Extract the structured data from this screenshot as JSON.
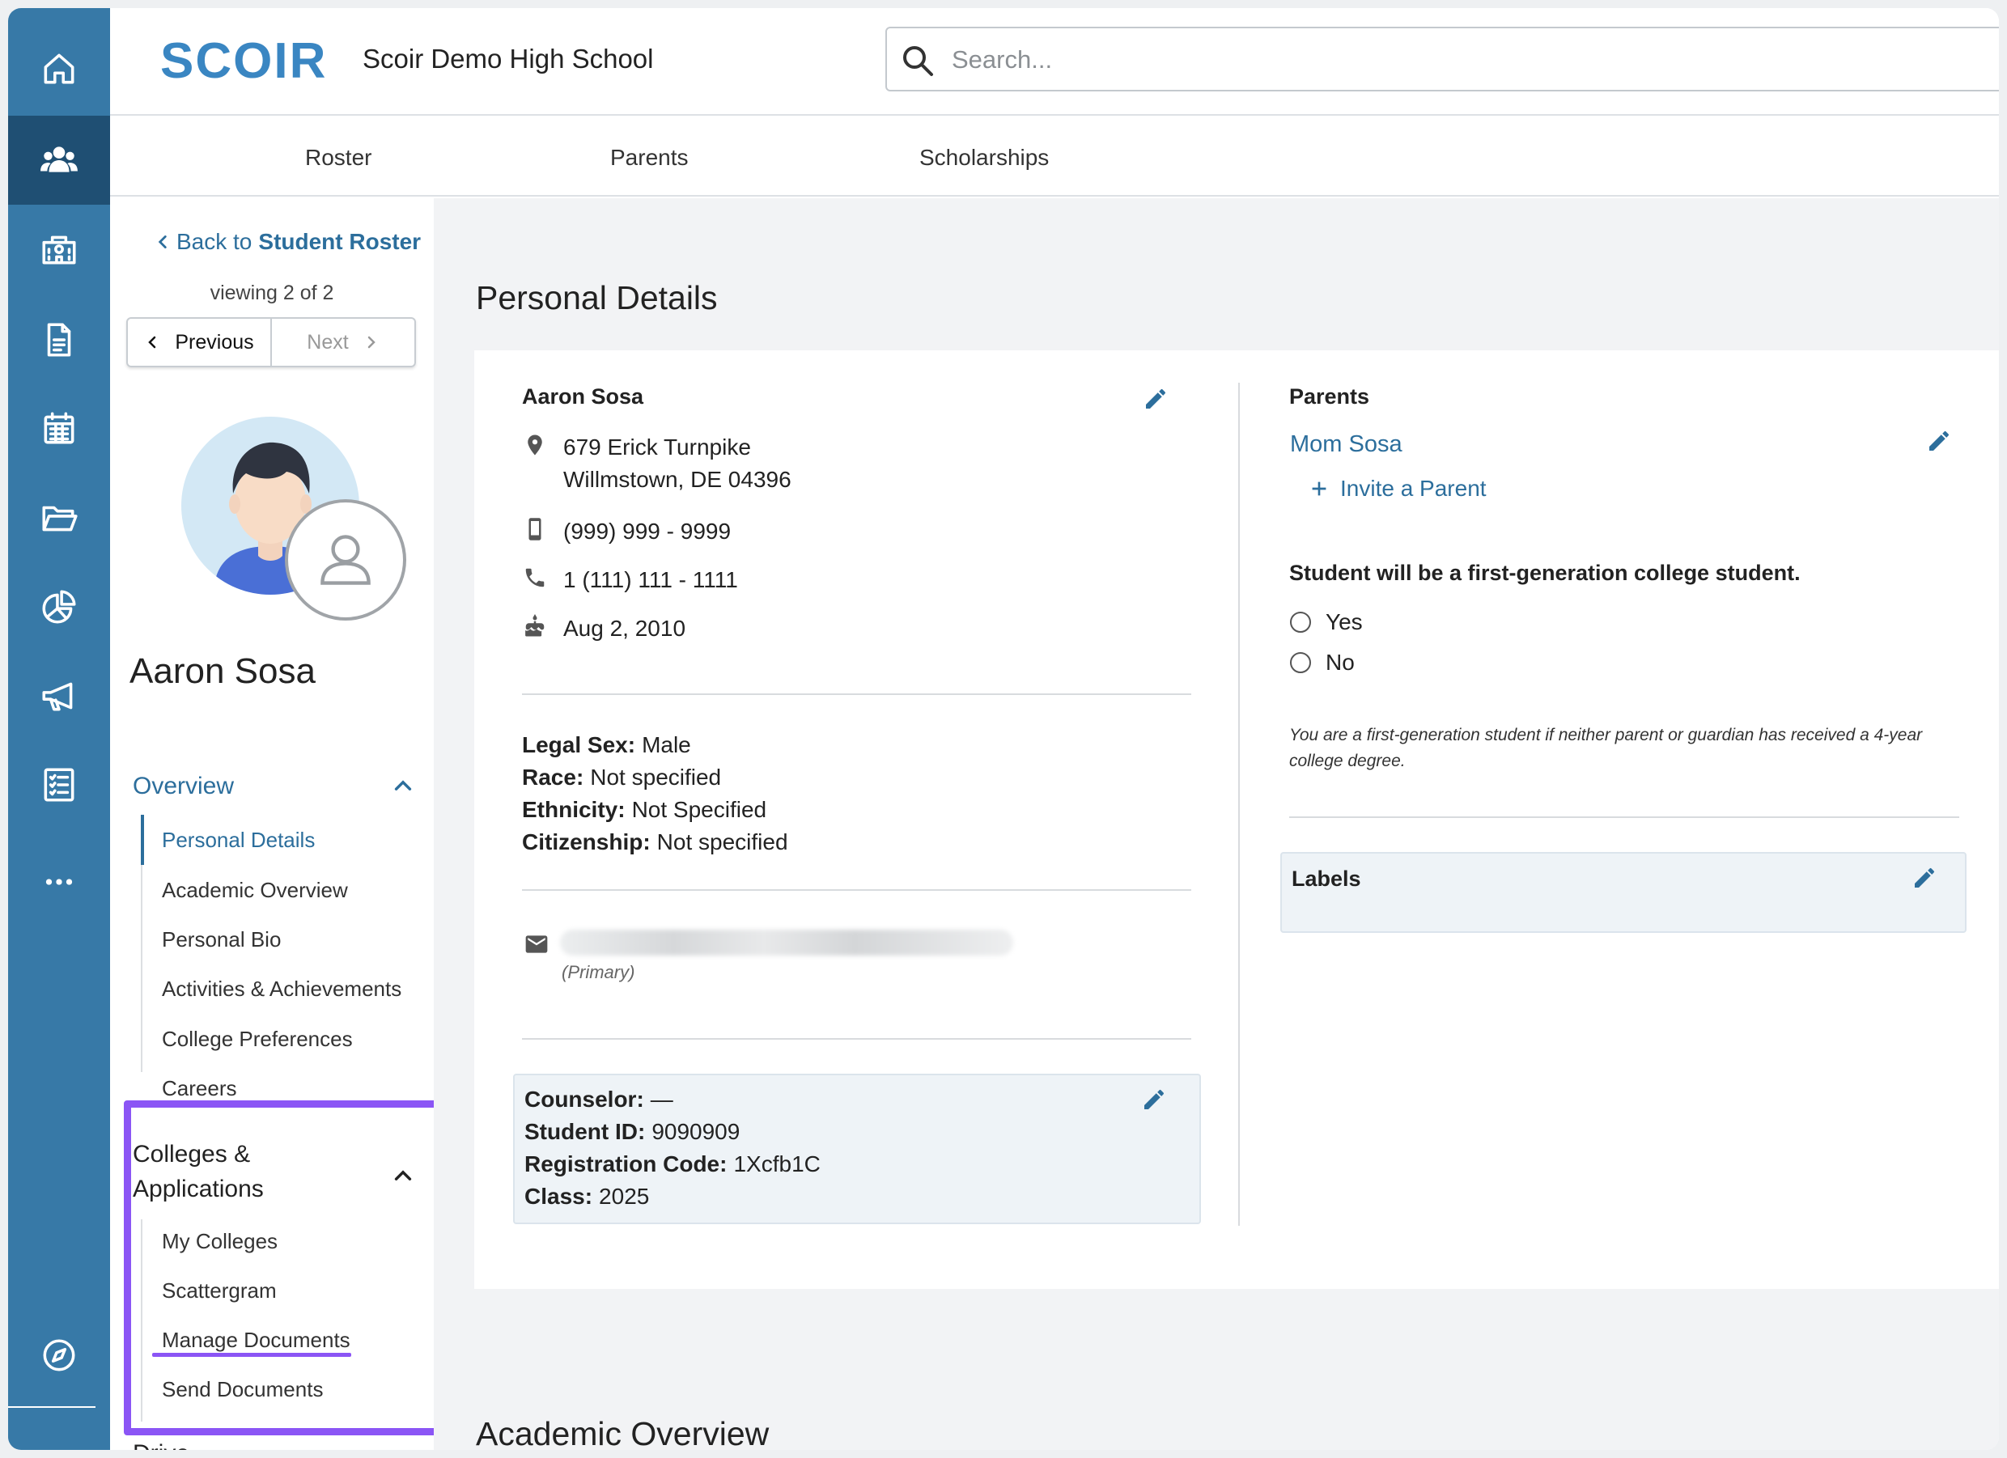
{
  "header": {
    "logo": "SCOIR",
    "school": "Scoir Demo High School",
    "search_placeholder": "Search..."
  },
  "tabs": [
    "Roster",
    "Parents",
    "Scholarships"
  ],
  "rail_icons": [
    "home-icon",
    "people-icon",
    "school-icon",
    "document-icon",
    "calendar-icon",
    "folder-icon",
    "chart-pie-icon",
    "megaphone-icon",
    "checklist-icon",
    "more-icon",
    "compass-icon"
  ],
  "side": {
    "back_prefix": "Back to",
    "back_link": "Student Roster",
    "viewing": "viewing 2 of 2",
    "previous": "Previous",
    "next": "Next",
    "student_name": "Aaron Sosa",
    "overview": {
      "title": "Overview",
      "items": [
        "Personal Details",
        "Academic Overview",
        "Personal Bio",
        "Activities & Achievements",
        "College Preferences",
        "Careers"
      ]
    },
    "colleges": {
      "title_line1": "Colleges &",
      "title_line2": "Applications",
      "items": [
        "My Colleges",
        "Scattergram",
        "Manage Documents",
        "Send Documents"
      ]
    },
    "next_section": "Drive"
  },
  "main": {
    "page_title": "Personal Details",
    "next_title": "Academic Overview",
    "contact": {
      "name": "Aaron Sosa",
      "address_line1": "679 Erick Turnpike",
      "address_line2": "Willmstown, DE 04396",
      "mobile": "(999) 999 - 9999",
      "phone": "1 (111) 111 - 1111",
      "birthday": "Aug 2, 2010"
    },
    "demographics": [
      {
        "label": "Legal Sex:",
        "value": "Male"
      },
      {
        "label": "Race:",
        "value": "Not specified"
      },
      {
        "label": "Ethnicity:",
        "value": "Not Specified"
      },
      {
        "label": "Citizenship:",
        "value": "Not specified"
      }
    ],
    "email_note": "(Primary)",
    "school_info": [
      {
        "label": "Counselor:",
        "value": "—"
      },
      {
        "label": "Student ID:",
        "value": "9090909"
      },
      {
        "label": "Registration Code:",
        "value": "1Xcfb1C"
      },
      {
        "label": "Class:",
        "value": "2025"
      }
    ],
    "parents": {
      "title": "Parents",
      "parent_name": "Mom Sosa",
      "invite": "Invite a Parent"
    },
    "first_gen": {
      "question": "Student will be a first-generation college student.",
      "options": [
        "Yes",
        "No"
      ],
      "note": "You are a first-generation student if neither parent or guardian has received a 4-year college degree."
    },
    "labels_title": "Labels"
  },
  "colors": {
    "rail": "#3779a7",
    "rail_active": "#1f4f73",
    "accent": "#2c6e9c",
    "highlight": "#8b55f5"
  }
}
